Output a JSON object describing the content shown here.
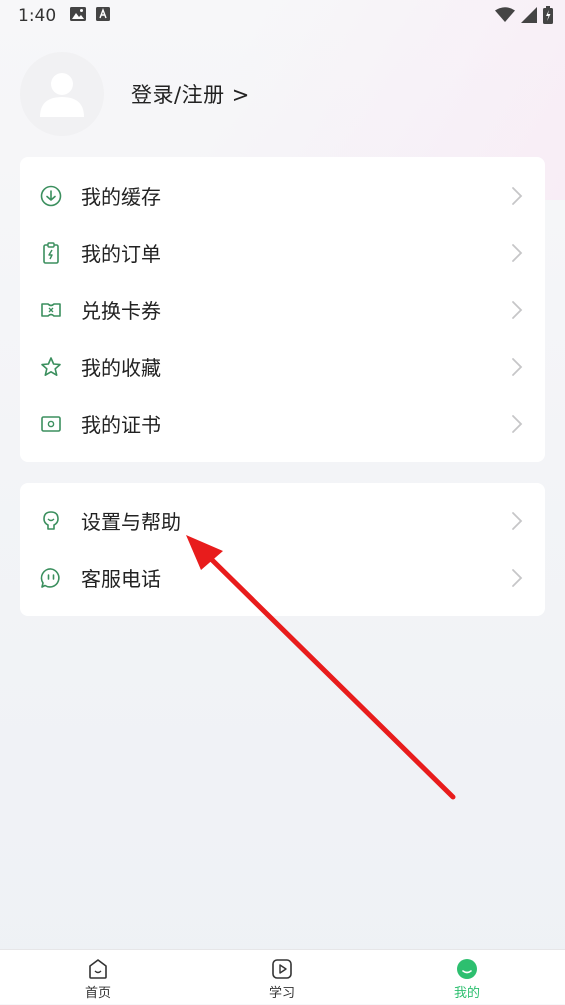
{
  "status_bar": {
    "time": "1:40",
    "icons": [
      "image-icon",
      "a-icon"
    ],
    "right_icons": [
      "wifi-icon",
      "signal-icon",
      "battery-charging-icon"
    ]
  },
  "profile": {
    "login_label": "登录/注册 >",
    "avatar_icon": "user-avatar-icon"
  },
  "menu_group_1": [
    {
      "label": "我的缓存",
      "icon": "download-icon"
    },
    {
      "label": "我的订单",
      "icon": "order-icon"
    },
    {
      "label": "兑换卡券",
      "icon": "ticket-icon"
    },
    {
      "label": "我的收藏",
      "icon": "star-icon"
    },
    {
      "label": "我的证书",
      "icon": "certificate-icon"
    }
  ],
  "menu_group_2": [
    {
      "label": "设置与帮助",
      "icon": "bulb-icon"
    },
    {
      "label": "客服电话",
      "icon": "chat-icon"
    }
  ],
  "tabbar": [
    {
      "label": "首页",
      "icon": "home-icon",
      "active": false
    },
    {
      "label": "学习",
      "icon": "play-icon",
      "active": false
    },
    {
      "label": "我的",
      "icon": "mine-icon",
      "active": true
    }
  ],
  "colors": {
    "accent": "#2dbf6f",
    "arrow": "#e81c1c",
    "icon_green": "#3b8f5e"
  }
}
